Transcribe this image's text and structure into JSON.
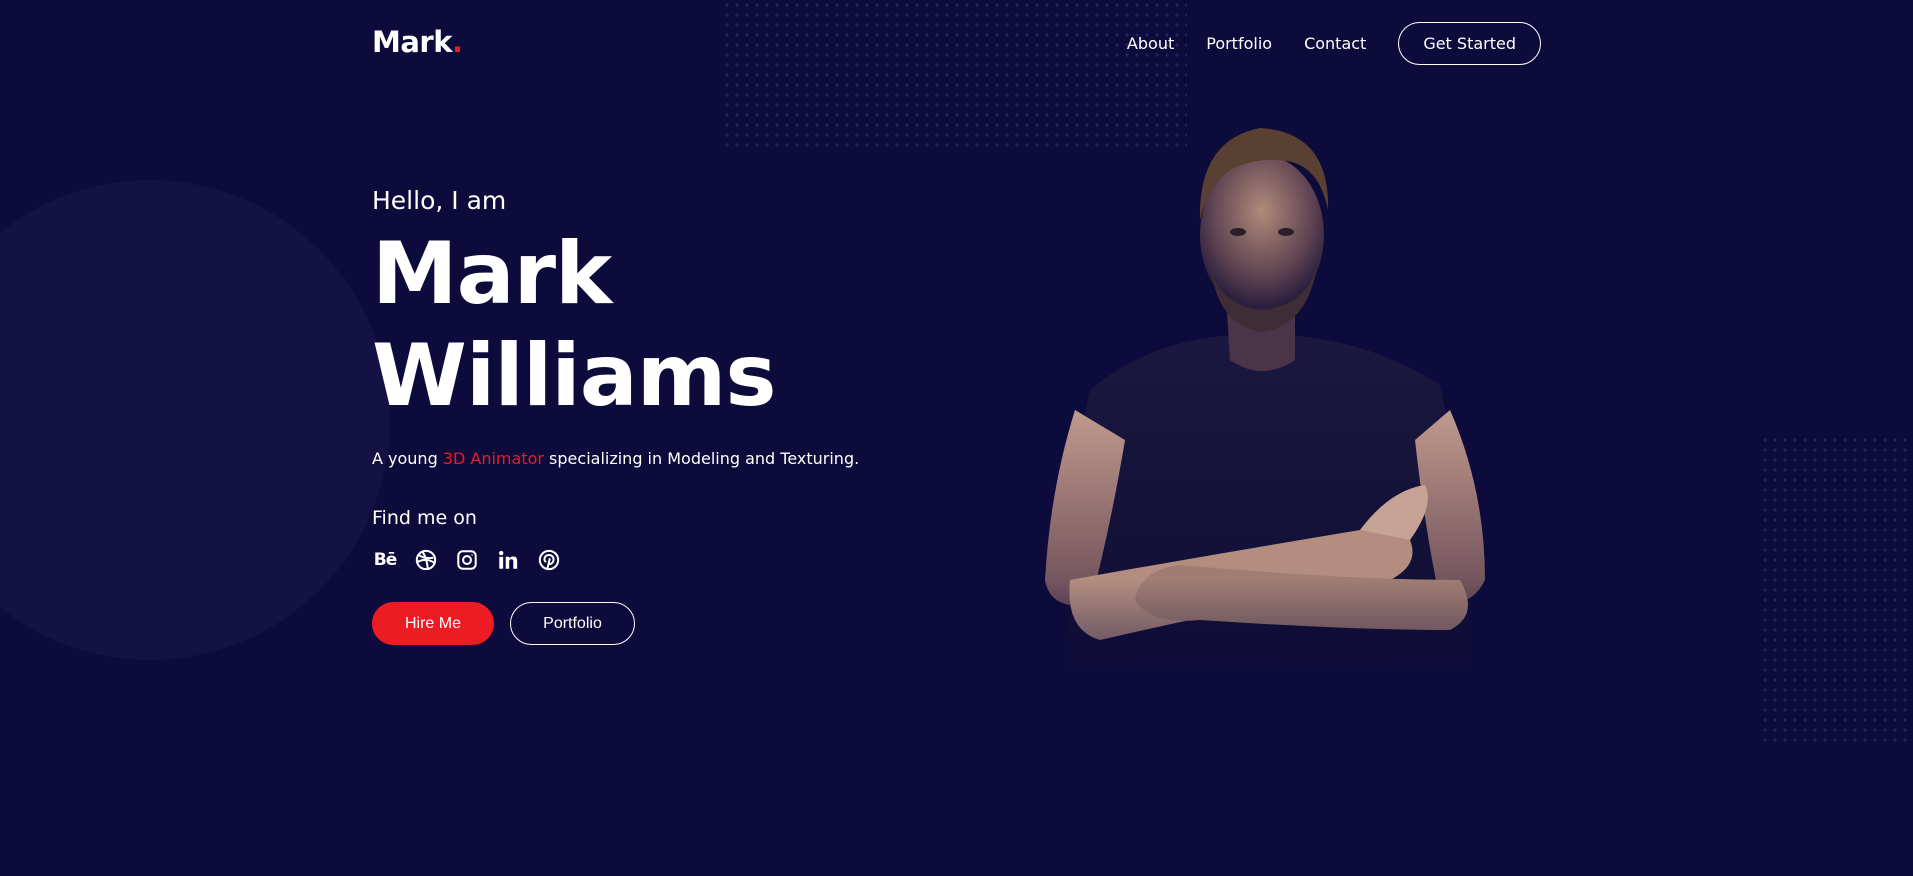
{
  "header": {
    "logo_text": "Mark",
    "logo_dot": ".",
    "nav": [
      {
        "label": "About"
      },
      {
        "label": "Portfolio"
      },
      {
        "label": "Contact"
      }
    ],
    "cta_label": "Get Started"
  },
  "hero": {
    "greeting": "Hello, I am",
    "name_line1": "Mark",
    "name_line2": "Williams",
    "tagline_pre": "A young ",
    "tagline_accent": "3D Animator",
    "tagline_post": " specializing in Modeling and Texturing.",
    "find_title": "Find me on",
    "socials": [
      {
        "icon": "behance-icon",
        "text": "Bē"
      },
      {
        "icon": "dribbble-icon"
      },
      {
        "icon": "instagram-icon"
      },
      {
        "icon": "linkedin-icon"
      },
      {
        "icon": "pinterest-icon"
      }
    ],
    "hire_label": "Hire Me",
    "portfolio_label": "Portfolio"
  },
  "colors": {
    "background": "#0d0b3b",
    "accent": "#ec1b24",
    "text": "#ffffff"
  }
}
